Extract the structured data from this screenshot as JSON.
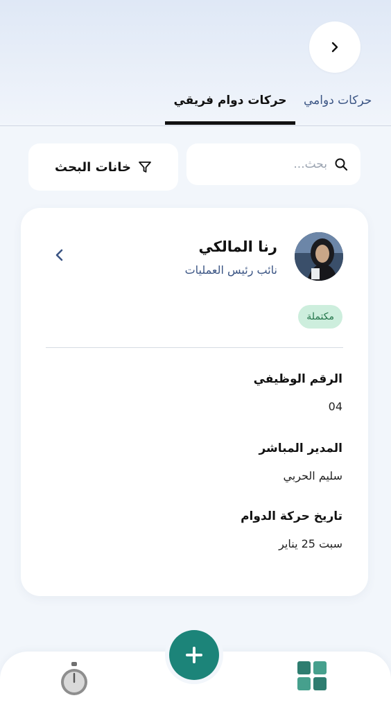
{
  "header": {
    "tabs": [
      {
        "label": "حركات دوامي",
        "active": false
      },
      {
        "label": "حركات دوام فريقي",
        "active": true
      }
    ]
  },
  "search": {
    "placeholder": "بحث..."
  },
  "filter": {
    "label": "خانات البحث"
  },
  "employee": {
    "name": "رنا المالكي",
    "role": "نائب رئيس العمليات",
    "status": "مكتملة",
    "fields": [
      {
        "label": "الرقم الوظيفي",
        "value": "04"
      },
      {
        "label": "المدير المباشر",
        "value": "سليم الحربي"
      },
      {
        "label": "تاريخ حركة الدوام",
        "value": "سبت 25 يناير"
      }
    ]
  },
  "bottom_nav": {
    "items": [
      {
        "icon": "stopwatch-icon"
      },
      {
        "icon": "plus-icon"
      },
      {
        "icon": "apps-grid-icon"
      }
    ]
  },
  "colors": {
    "accent": "#1c8479",
    "status_bg": "#cdeedd",
    "status_text": "#23754a",
    "link_blue": "#3b5584"
  }
}
